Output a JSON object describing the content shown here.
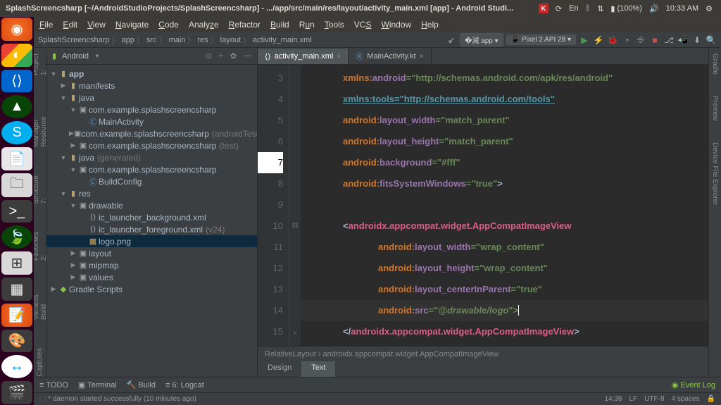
{
  "sysbar": {
    "title": "SplashScreencsharp [~/AndroidStudioProjects/SplashScreencsharp] - .../app/src/main/res/layout/activity_main.xml [app] - Android Studi...",
    "battery": "(100%)",
    "time": "10:33 AM",
    "lang": "En"
  },
  "menu": [
    "File",
    "Edit",
    "View",
    "Navigate",
    "Code",
    "Analyze",
    "Refactor",
    "Build",
    "Run",
    "Tools",
    "VCS",
    "Window",
    "Help"
  ],
  "crumbs": [
    "SplashScreencsharp",
    "app",
    "src",
    "main",
    "res",
    "layout",
    "activity_main.xml"
  ],
  "run": {
    "config": "app",
    "device": "Pixel 2 API 28"
  },
  "tree_header": "Android",
  "tree": {
    "root": "app",
    "manifests": "manifests",
    "java": "java",
    "pkg": "com.example.splashscreencsharp",
    "main_act": "MainActivity",
    "android_test": "(androidTest)",
    "test": "(test)",
    "java_gen": "java",
    "gen": "(generated)",
    "build_config": "BuildConfig",
    "res": "res",
    "drawable": "drawable",
    "ic_bg": "ic_launcher_background.xml",
    "ic_fg": "ic_launcher_foreground.xml",
    "ic_fg_v": "(v24)",
    "logo": "logo.png",
    "layout": "layout",
    "mipmap": "mipmap",
    "values": "values",
    "gradle": "Gradle Scripts"
  },
  "tabs": {
    "t1": "activity_main.xml",
    "t2": "MainActivity.kt"
  },
  "code": {
    "l3a": "xmlns:",
    "l3b": "android",
    "l3c": "=\"http://schemas.android.com/apk/res/android\"",
    "l4a": "xmlns:tools",
    "l4b": "=\"http://schemas.android.com/tools\"",
    "l5a": "android:",
    "l5b": "layout_width",
    "l5c": "=\"match_parent\"",
    "l6a": "android:",
    "l6b": "layout_height",
    "l6c": "=\"match_parent\"",
    "l7a": "android:",
    "l7b": "background",
    "l7c": "=\"#fff\"",
    "l8a": "android:",
    "l8b": "fitsSystemWindows",
    "l8c": "=\"true\"",
    "l8d": ">",
    "l10a": "<",
    "l10b": "androidx.appcompat.widget.AppCompatImageView",
    "l11a": "android:",
    "l11b": "layout_width",
    "l11c": "=\"wrap_content\"",
    "l12a": "android:",
    "l12b": "layout_height",
    "l12c": "=\"wrap_content\"",
    "l13a": "android:",
    "l13b": "layout_centerInParent",
    "l13c": "=\"true\"",
    "l14a": "android:",
    "l14b": "src",
    "l14c": "=\"",
    "l14d": "@drawable/logo",
    "l14e": "\">",
    "l15a": "</",
    "l15b": "androidx.appcompat.widget.AppCompatImageView",
    "l15c": ">"
  },
  "breadcrumb_bot": "RelativeLayout  ›  androidx.appcompat.widget.AppCompatImageView",
  "designtabs": {
    "d": "Design",
    "t": "Text"
  },
  "bottom": {
    "todo": "TODO",
    "term": "Terminal",
    "build": "Build",
    "logcat": "6: Logcat",
    "event": "Event Log"
  },
  "status": {
    "msg": "* daemon started successfully (10 minutes ago)",
    "pos": "14:38",
    "le": "LF",
    "enc": "UTF-8",
    "ind": "4 spaces"
  },
  "left_tools": [
    "1: Project",
    "Resource Manager",
    "7: Structure",
    "2: Favorites",
    "Build Variants",
    "Captures"
  ],
  "right_tools": [
    "Gradle",
    "Preview",
    "Device File Explorer"
  ]
}
